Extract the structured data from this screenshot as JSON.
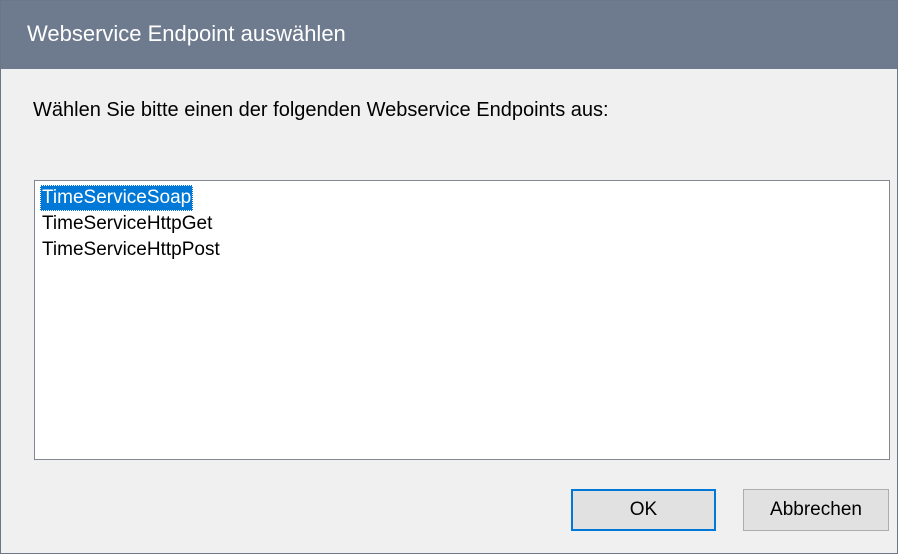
{
  "window": {
    "title": "Webservice Endpoint auswählen"
  },
  "dialog": {
    "prompt": "Wählen Sie bitte einen der folgenden Webservice Endpoints aus:",
    "endpoints": [
      {
        "label": "TimeServiceSoap",
        "selected": true
      },
      {
        "label": "TimeServiceHttpGet",
        "selected": false
      },
      {
        "label": "TimeServiceHttpPost",
        "selected": false
      }
    ]
  },
  "buttons": {
    "ok_label": "OK",
    "cancel_label": "Abbrechen"
  },
  "colors": {
    "title_bar": "#6e7b8e",
    "selection": "#0078d7",
    "dialog_background": "#f0f0f0"
  }
}
